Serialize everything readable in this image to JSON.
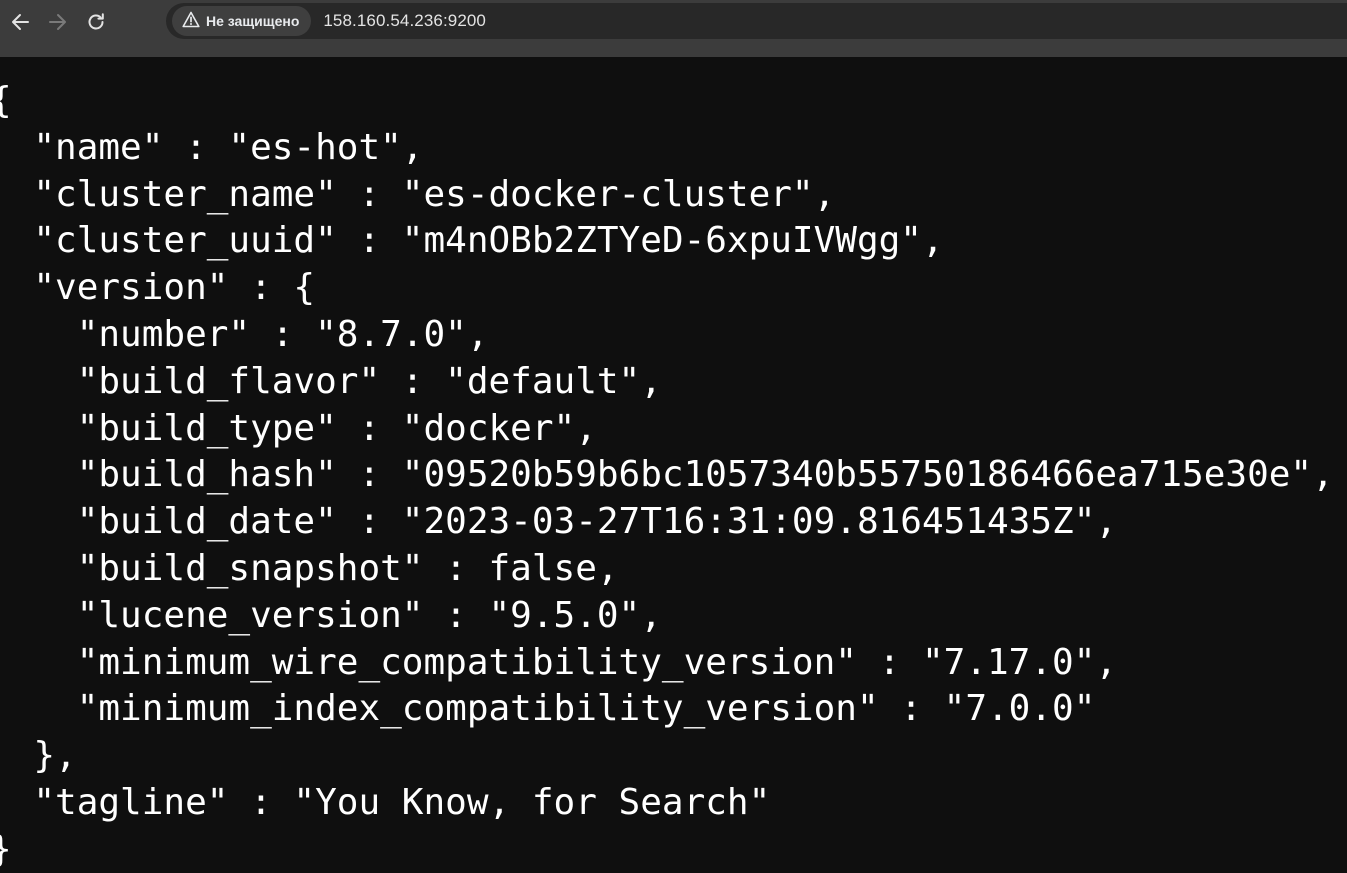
{
  "browser": {
    "security_label": "Не защищено",
    "url": "158.160.54.236:9200",
    "icons": {
      "back": "arrow-left-icon",
      "forward": "arrow-right-icon",
      "reload": "reload-icon",
      "security": "warning-triangle-icon"
    }
  },
  "page": {
    "lines": [
      "{",
      "  \"name\" : \"es-hot\",",
      "  \"cluster_name\" : \"es-docker-cluster\",",
      "  \"cluster_uuid\" : \"m4nOBb2ZTYeD-6xpuIVWgg\",",
      "  \"version\" : {",
      "    \"number\" : \"8.7.0\",",
      "    \"build_flavor\" : \"default\",",
      "    \"build_type\" : \"docker\",",
      "    \"build_hash\" : \"09520b59b6bc1057340b55750186466ea715e30e\",",
      "    \"build_date\" : \"2023-03-27T16:31:09.816451435Z\",",
      "    \"build_snapshot\" : false,",
      "    \"lucene_version\" : \"9.5.0\",",
      "    \"minimum_wire_compatibility_version\" : \"7.17.0\",",
      "    \"minimum_index_compatibility_version\" : \"7.0.0\"",
      "  },",
      "  \"tagline\" : \"You Know, for Search\"",
      "}"
    ]
  }
}
